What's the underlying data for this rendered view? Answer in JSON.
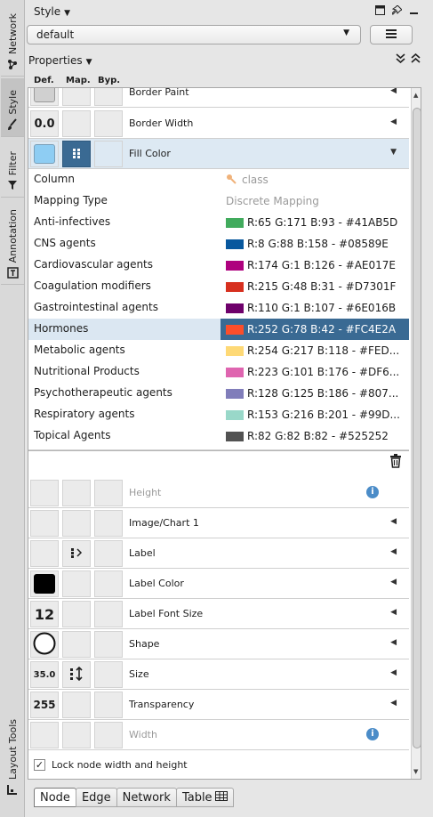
{
  "side_tabs": {
    "network": "Network",
    "style": "Style",
    "filter": "Filter",
    "annotation": "Annotation",
    "layout_tools": "Layout Tools"
  },
  "header": {
    "title": "Style",
    "style_value": "default",
    "properties_label": "Properties"
  },
  "columns": {
    "def": "Def.",
    "map": "Map.",
    "byp": "Byp."
  },
  "properties": {
    "border_paint": "Border Paint",
    "border_width": "Border Width",
    "border_width_value": "0.0",
    "fill_color": "Fill Color",
    "height": "Height",
    "image_chart": "Image/Chart 1",
    "label": "Label",
    "label_color": "Label Color",
    "label_font_size": "Label Font Size",
    "label_font_size_value": "12",
    "shape": "Shape",
    "size": "Size",
    "size_value": "35.0",
    "transparency": "Transparency",
    "transparency_value": "255",
    "width": "Width"
  },
  "mapping": {
    "column_key": "Column",
    "column_value": "class",
    "type_key": "Mapping Type",
    "type_value": "Discrete Mapping",
    "entries": [
      {
        "key": "Anti-infectives",
        "value": "R:65 G:171 B:93 - #41AB5D",
        "color": "#41AB5D"
      },
      {
        "key": "CNS agents",
        "value": "R:8 G:88 B:158 - #08589E",
        "color": "#08589E"
      },
      {
        "key": "Cardiovascular agents",
        "value": "R:174 G:1 B:126 - #AE017E",
        "color": "#AE017E"
      },
      {
        "key": "Coagulation modifiers",
        "value": "R:215 G:48 B:31 - #D7301F",
        "color": "#D7301F"
      },
      {
        "key": "Gastrointestinal agents",
        "value": "R:110 G:1 B:107 - #6E016B",
        "color": "#6E016B"
      },
      {
        "key": "Hormones",
        "value": "R:252 G:78 B:42 - #FC4E2A",
        "color": "#FC4E2A"
      },
      {
        "key": "Metabolic agents",
        "value": "R:254 G:217 B:118 - #FED...",
        "color": "#FED976"
      },
      {
        "key": "Nutritional Products",
        "value": "R:223 G:101 B:176 - #DF6...",
        "color": "#DF65B0"
      },
      {
        "key": "Psychotherapeutic agents",
        "value": "R:128 G:125 B:186 - #807...",
        "color": "#807DBA"
      },
      {
        "key": "Respiratory agents",
        "value": "R:153 G:216 B:201 - #99D...",
        "color": "#99D8C9"
      },
      {
        "key": "Topical Agents",
        "value": "R:82 G:82 B:82 - #525252",
        "color": "#525252"
      }
    ],
    "selected": "Hormones"
  },
  "lock_label": "Lock node width and height",
  "bottom_tabs": [
    "Node",
    "Edge",
    "Network",
    "Table"
  ],
  "colors": {
    "fill_color_default": "#8ECDF3",
    "selection": "#3A6A93",
    "accent_blue": "#4B8CC8"
  }
}
